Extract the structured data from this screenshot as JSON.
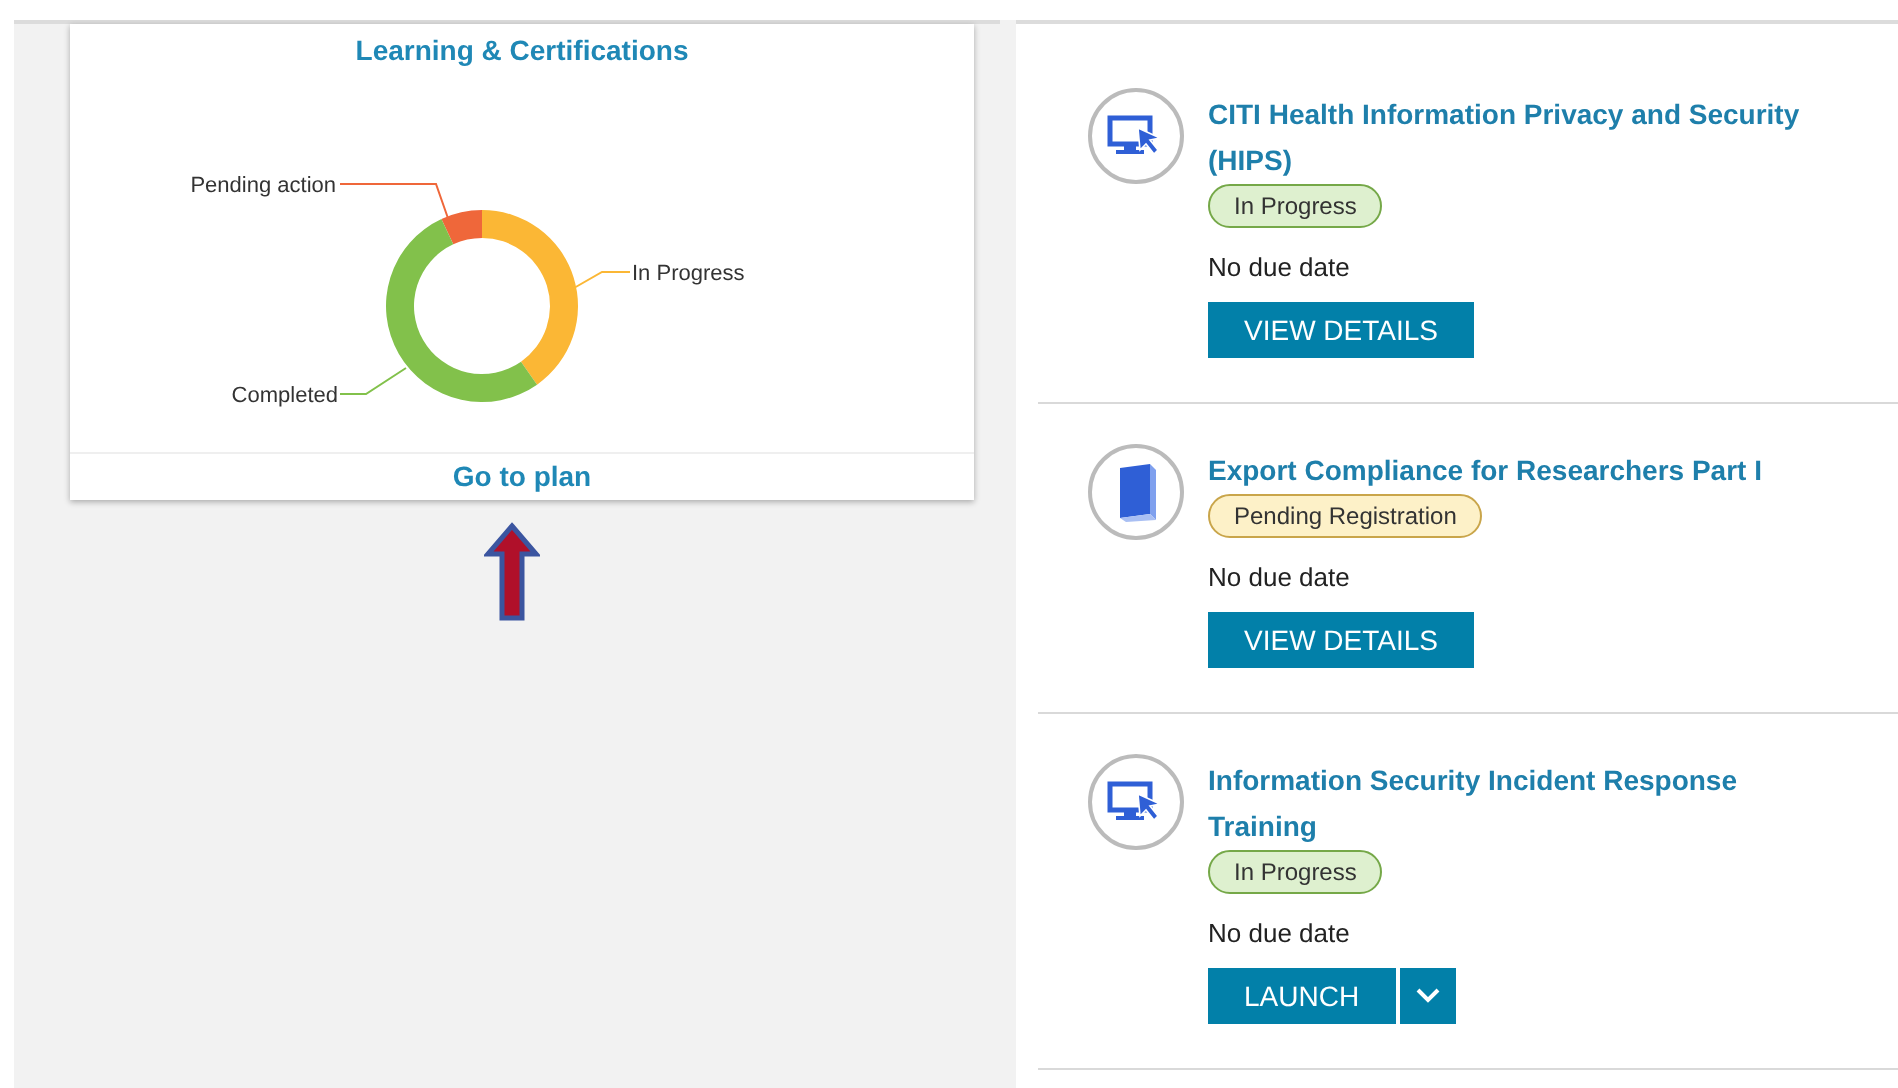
{
  "summary_card": {
    "title": "Learning & Certifications",
    "segments": [
      {
        "label": "Pending action",
        "color": "#ef673a"
      },
      {
        "label": "In Progress",
        "color": "#fbb735"
      },
      {
        "label": "Completed",
        "color": "#82c14b"
      }
    ],
    "link": "Go to plan"
  },
  "items": [
    {
      "kind": "monitor",
      "title": "CITI Health Information Privacy and Security (HIPS)",
      "status": {
        "label": "In Progress",
        "kind": "in-progress"
      },
      "due": "No due date",
      "action": {
        "label": "VIEW DETAILS",
        "menu": false
      }
    },
    {
      "kind": "book",
      "title": "Export Compliance for Researchers Part I",
      "status": {
        "label": "Pending Registration",
        "kind": "pending"
      },
      "due": "No due date",
      "action": {
        "label": "VIEW DETAILS",
        "menu": false
      }
    },
    {
      "kind": "monitor",
      "title": "Information Security Incident Response Training",
      "status": {
        "label": "In Progress",
        "kind": "in-progress"
      },
      "due": "No due date",
      "action": {
        "label": "LAUNCH",
        "menu": true
      }
    }
  ]
}
